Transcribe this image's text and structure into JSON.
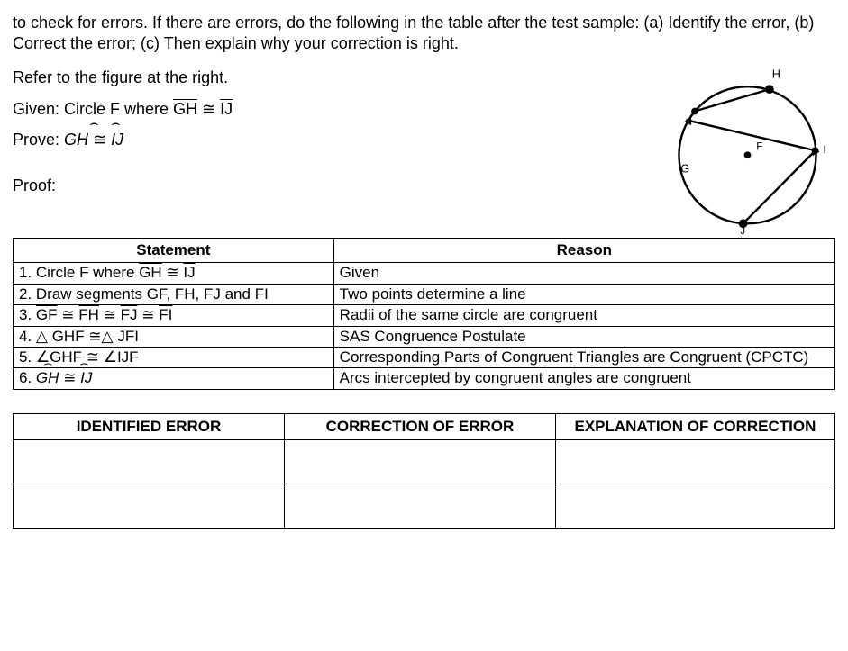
{
  "intro": "to check for errors. If there are errors, do the following in the table after the test sample: (a) Identify the error, (b) Correct the error; (c) Then explain why your correction is right.",
  "refer": "Refer to the figure at the right.",
  "given_prefix": "Given: Circle F where ",
  "given_lhs": "GH",
  "given_op": " ≅ ",
  "given_rhs": "IJ",
  "prove_prefix": "Prove: ",
  "prove_lhs": "GH",
  "prove_op": " ≅ ",
  "prove_rhs": "IJ",
  "proof_label": "Proof:",
  "hdr_statement": "Statement",
  "hdr_reason": "Reason",
  "s1_a": "1. Circle F where ",
  "s1_b": "GH",
  "s1_c": " ≅ ",
  "s1_d": "IJ",
  "r1": "Given",
  "s2": "2. Draw segments GF, FH, FJ and FI",
  "r2": "Two points determine a line",
  "s3_a": "3. ",
  "s3_b": "GF",
  "s3_c": " ≅ ",
  "s3_d": "FH",
  "s3_e": " ≅ ",
  "s3_f": "FJ",
  "s3_g": " ≅ ",
  "s3_h": "FI",
  "r3": "Radii of the same circle are congruent",
  "s4": "4. △ GHF ≅△ JFI",
  "r4": "SAS Congruence Postulate",
  "s5": "5. ∠GHF ≅ ∠IJF",
  "r5": "Corresponding Parts of Congruent Triangles are Congruent (CPCTC)",
  "s6_a": "6. ",
  "s6_b": "GH",
  "s6_c": " ≅ ",
  "s6_d": "IJ",
  "r6": "Arcs intercepted by congruent angles are congruent",
  "err_h1": "IDENTIFIED ERROR",
  "err_h2": "CORRECTION OF ERROR",
  "err_h3": "EXPLANATION OF CORRECTION",
  "fig": {
    "H": "H",
    "I": "I",
    "G": "G",
    "J": "J",
    "F": "F"
  }
}
